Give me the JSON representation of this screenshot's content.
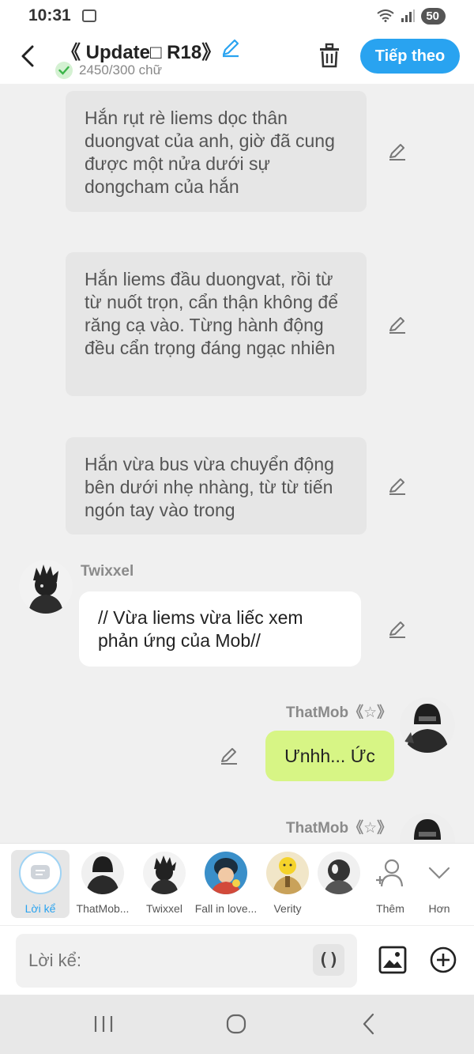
{
  "status_bar": {
    "time": "10:31",
    "battery": "50"
  },
  "header": {
    "title": "《 Update□ R18》",
    "word_count": "2450/300 chữ",
    "next_label": "Tiếp theo"
  },
  "messages": [
    {
      "type": "narration",
      "text": "Hắn rụt rè liems dọc thân duongvat của anh, giờ đã cung được một nửa dưới sự dongcham của hắn"
    },
    {
      "type": "narration",
      "text": "Hắn liems đầu duongvat, rồi từ từ nuốt trọn, cẩn thận không để răng cạ vào. Từng hành động đều cẩn trọng đáng ngạc nhiên"
    },
    {
      "type": "narration",
      "text": "Hắn vừa bus vừa chuyển động bên dưới nhẹ nhàng, từ từ tiến ngón tay vào trong"
    },
    {
      "type": "character",
      "name": "Twixxel",
      "text": "// Vừa liems vừa liếc xem phản ứng của Mob//"
    },
    {
      "type": "character",
      "name": "ThatMob《☆》",
      "text": "Ưnhh... Ức"
    },
    {
      "type": "character",
      "name": "ThatMob《☆》",
      "text": ""
    }
  ],
  "character_bar": {
    "narration_label": "Lời kể",
    "characters": [
      {
        "label": "ThatMob..."
      },
      {
        "label": "Twixxel"
      },
      {
        "label": "Fall in love..."
      },
      {
        "label": "Verity"
      },
      {
        "label": ""
      }
    ],
    "add_label": "Thêm",
    "more_label": "Hơn"
  },
  "input": {
    "placeholder": "Lời kể:",
    "paren_label": "()"
  },
  "colors": {
    "accent": "#29a3f0",
    "bubble_right": "#d7f585",
    "narration_bg": "#e6e6e6"
  }
}
